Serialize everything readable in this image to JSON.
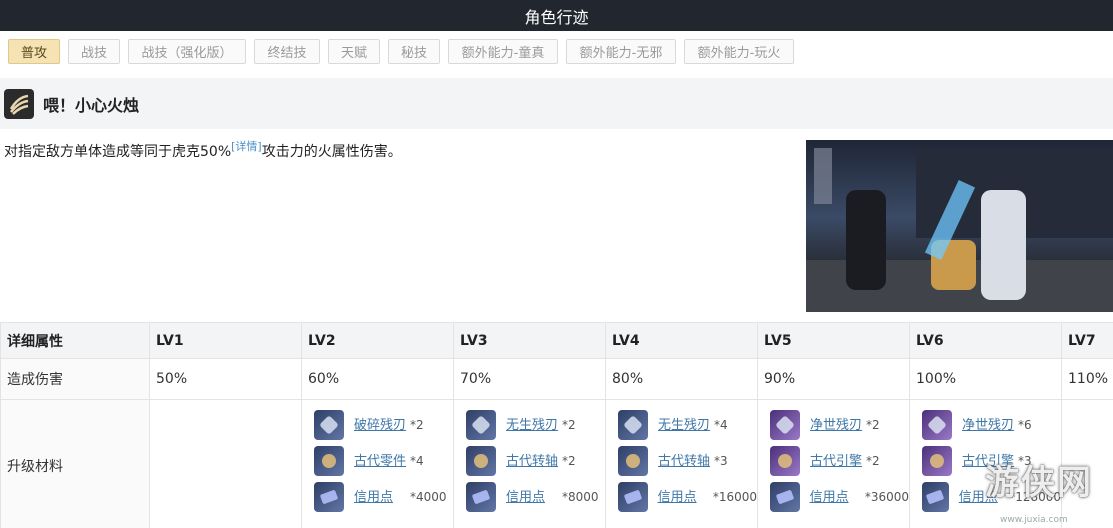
{
  "title": "角色行迹",
  "tabs": [
    "普攻",
    "战技",
    "战技（强化版）",
    "终结技",
    "天赋",
    "秘技",
    "额外能力-童真",
    "额外能力-无邪",
    "额外能力-玩火"
  ],
  "active_tab": 0,
  "skill": {
    "name": "喂！小心火烛",
    "desc_before": "对指定敌方单体造成等同于虎克50%",
    "desc_link": "[详情]",
    "desc_after": "攻击力的火属性伤害。"
  },
  "table": {
    "header": [
      "详细属性",
      "LV1",
      "LV2",
      "LV3",
      "LV4",
      "LV5",
      "LV6",
      "LV7"
    ],
    "damage_label": "造成伤害",
    "damage": [
      "50%",
      "60%",
      "70%",
      "80%",
      "90%",
      "100%",
      "110%"
    ],
    "material_label": "升级材料",
    "materials": [
      [],
      [
        {
          "name": "破碎残刃",
          "qty": "*2"
        },
        {
          "name": "古代零件",
          "qty": "*4"
        },
        {
          "name": "信用点",
          "qty": "*4000"
        }
      ],
      [
        {
          "name": "无生残刃",
          "qty": "*2"
        },
        {
          "name": "古代转轴",
          "qty": "*2"
        },
        {
          "name": "信用点",
          "qty": "*8000"
        }
      ],
      [
        {
          "name": "无生残刃",
          "qty": "*4"
        },
        {
          "name": "古代转轴",
          "qty": "*3"
        },
        {
          "name": "信用点",
          "qty": "*16000"
        }
      ],
      [
        {
          "name": "净世残刃",
          "qty": "*2"
        },
        {
          "name": "古代引擎",
          "qty": "*2"
        },
        {
          "name": "信用点",
          "qty": "*36000"
        }
      ],
      [
        {
          "name": "净世残刃",
          "qty": "*6"
        },
        {
          "name": "古代引擎",
          "qty": "*3"
        },
        {
          "name": "信用点",
          "qty": "*128000"
        }
      ],
      []
    ]
  },
  "watermark": "游侠网",
  "watermark_url": "www.juxia.com",
  "colors": {
    "titlebar": "#22272f",
    "active_tab": "#f5e3b3",
    "link": "#3f78a8"
  }
}
